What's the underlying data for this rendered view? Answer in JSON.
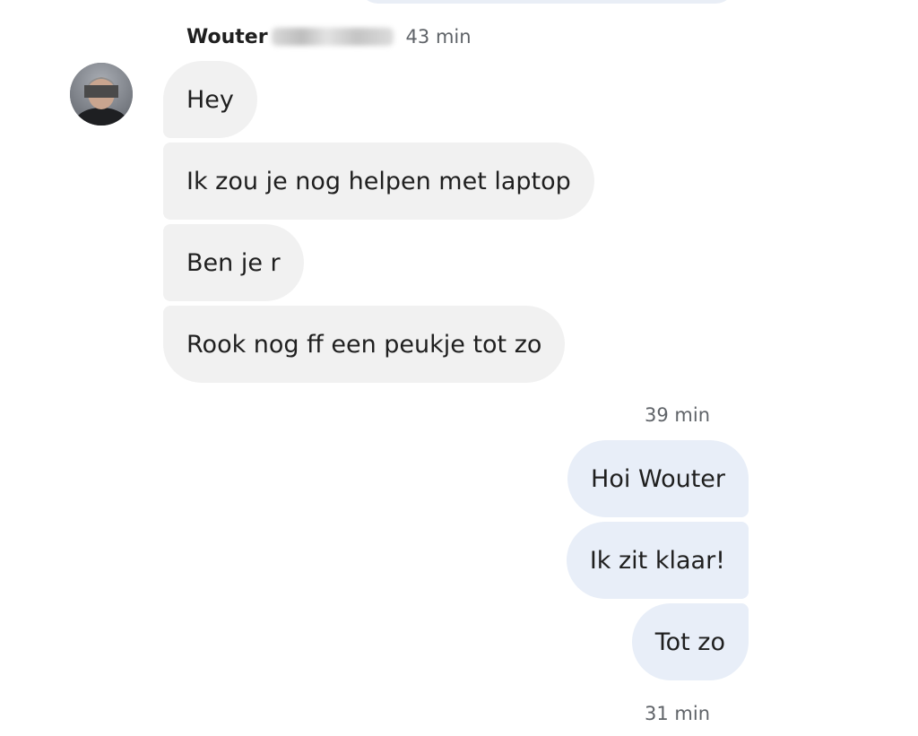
{
  "conversation": {
    "incoming": {
      "sender_name": "Wouter",
      "time": "43 min",
      "messages": [
        "Hey",
        "Ik zou je nog helpen met laptop",
        "Ben je r",
        "Rook nog ff een peukje tot zo"
      ]
    },
    "outgoing": {
      "time": "39 min",
      "messages": [
        "Hoi Wouter",
        "Ik zit klaar!",
        "Tot zo"
      ]
    },
    "footer_time": "31 min"
  },
  "colors": {
    "incoming_bubble": "#f1f1f1",
    "outgoing_bubble": "#e8eef8",
    "timestamp_text": "#5f6368",
    "message_text": "#1f1f1f"
  },
  "icons": {
    "avatar": "person-avatar-icon"
  }
}
